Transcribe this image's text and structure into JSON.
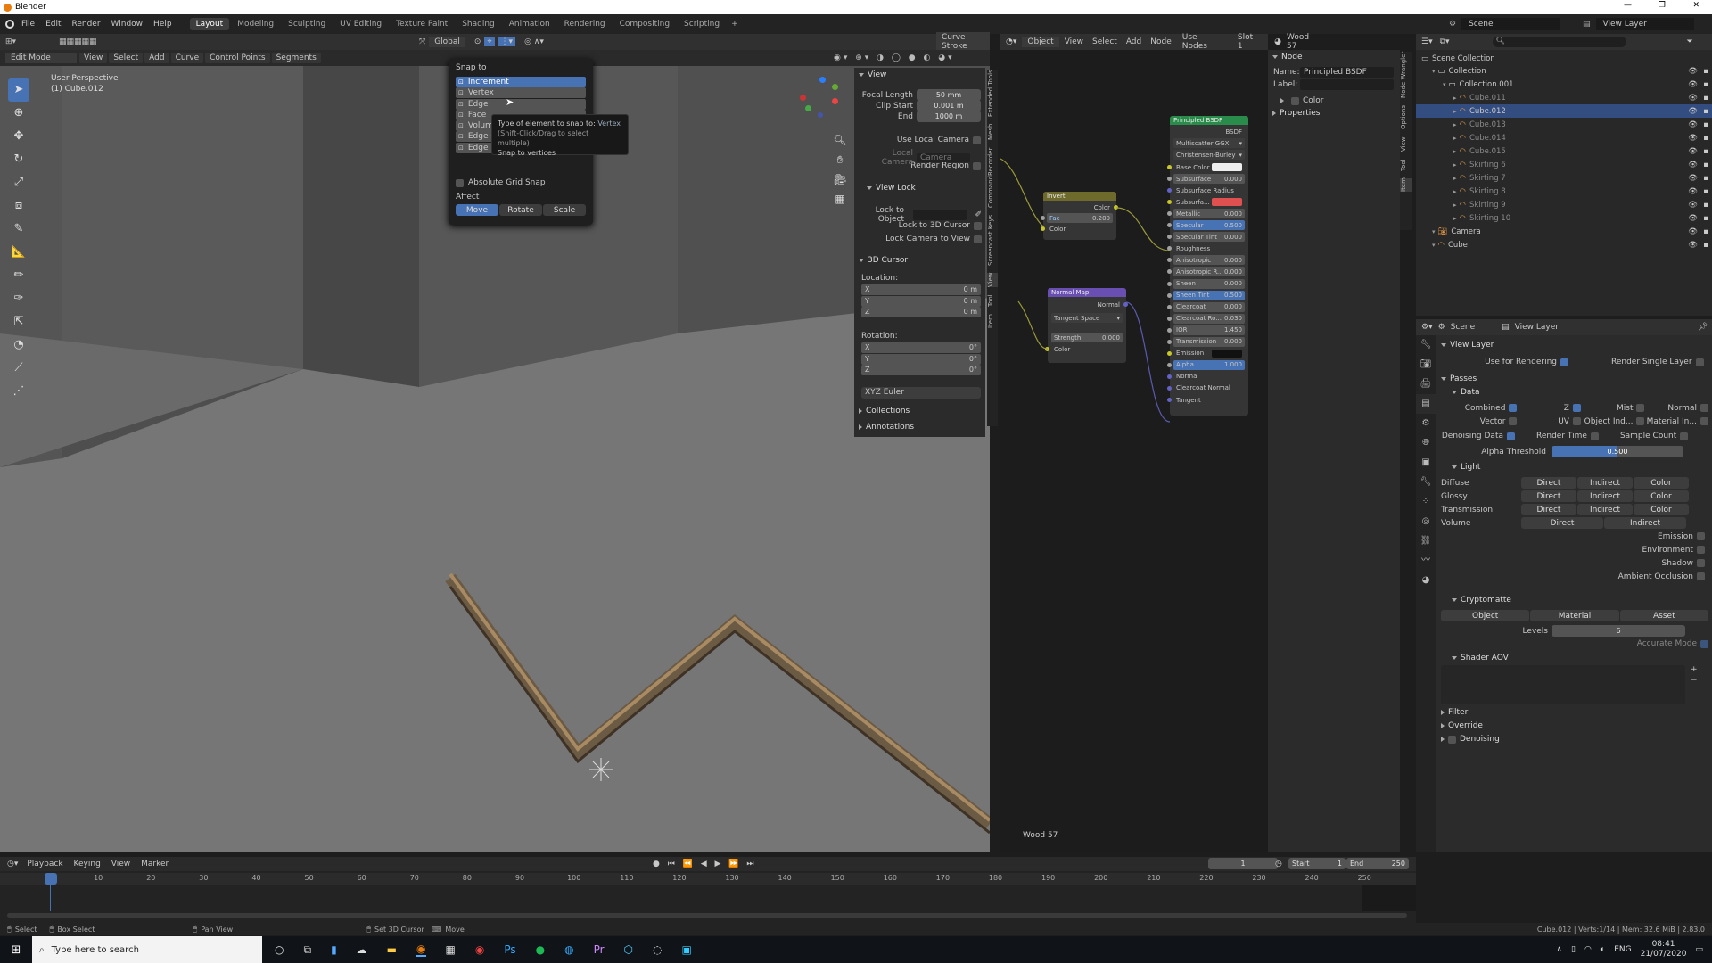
{
  "app_title": "Blender",
  "menu": [
    "File",
    "Edit",
    "Render",
    "Window",
    "Help"
  ],
  "workspaces": [
    "Layout",
    "Modeling",
    "Sculpting",
    "UV Editing",
    "Texture Paint",
    "Shading",
    "Animation",
    "Rendering",
    "Compositing",
    "Scripting"
  ],
  "scene": "Scene",
  "view_layer": "View Layer",
  "viewport": {
    "mode": "Edit Mode",
    "menus": [
      "View",
      "Select",
      "Add",
      "Curve",
      "Control Points",
      "Segments"
    ],
    "orientation": "Global",
    "curve_stroke": "Curve Stroke",
    "perspective": "User Perspective",
    "object_label": "(1) Cube.012"
  },
  "snap": {
    "title": "Snap to",
    "items": [
      "Increment",
      "Vertex",
      "Edge",
      "Face",
      "Volume",
      "Edge Center",
      "Edge Perpendicular"
    ],
    "absolute_grid": "Absolute Grid Snap",
    "affect": "Affect",
    "affect_buttons": [
      "Move",
      "Rotate",
      "Scale"
    ],
    "tooltip": {
      "line1_prefix": "Type of element to snap to:",
      "line1_value": "Vertex",
      "line2": "(Shift-Click/Drag to select multiple)",
      "line3": "Snap to vertices"
    }
  },
  "n_panel": {
    "view_header": "View",
    "focal_label": "Focal Length",
    "focal": "50 mm",
    "clip_start_label": "Clip Start",
    "clip_start": "0.001 m",
    "end_label": "End",
    "clip_end": "1000 m",
    "use_local_camera": "Use Local Camera",
    "local_camera": "Local Camera",
    "camera_placeholder": "Camera",
    "render_region": "Render Region",
    "view_lock": "View Lock",
    "lock_object": "Lock to Object",
    "lock_cursor": "Lock to 3D Cursor",
    "lock_camera": "Lock Camera to View",
    "cursor_header": "3D Cursor",
    "location": "Location:",
    "rotation": "Rotation:",
    "loc": [
      [
        "X",
        "0 m"
      ],
      [
        "Y",
        "0 m"
      ],
      [
        "Z",
        "0 m"
      ]
    ],
    "rot": [
      [
        "X",
        "0°"
      ],
      [
        "Y",
        "0°"
      ],
      [
        "Z",
        "0°"
      ]
    ],
    "euler": "XYZ Euler",
    "collections": "Collections",
    "annotations": "Annotations",
    "tabs": [
      "Item",
      "Tool",
      "View",
      "Screencast Keys",
      "CommandRecorder",
      "Mesh",
      "Extended Tools"
    ]
  },
  "node_editor": {
    "object": "Object",
    "menus": [
      "View",
      "Select",
      "Add",
      "Node"
    ],
    "use_nodes": "Use Nodes",
    "slot": "Slot 1",
    "material": "Wood 57",
    "footer_material": "Wood 57",
    "invert": {
      "title": "Invert",
      "out": "Color",
      "fac": "Fac",
      "fac_val": "0.200",
      "color": "Color"
    },
    "normal_map": {
      "title": "Normal Map",
      "out": "Normal",
      "space": "Tangent Space",
      "strength": "Strength",
      "strength_val": "0.000",
      "color": "Color"
    },
    "bsdf": {
      "title": "Principled BSDF",
      "out": "BSDF",
      "dist": "Multiscatter GGX",
      "sss": "Christensen-Burley",
      "rows": [
        [
          "Base Color",
          ""
        ],
        [
          "Subsurface",
          "0.000"
        ],
        [
          "Subsurface Radius",
          ""
        ],
        [
          "Subsurfa...",
          ""
        ],
        [
          "Metallic",
          "0.000"
        ],
        [
          "Specular",
          "0.500"
        ],
        [
          "Specular Tint",
          "0.000"
        ],
        [
          "Roughness",
          ""
        ],
        [
          "Anisotropic",
          "0.000"
        ],
        [
          "Anisotropic R...",
          "0.000"
        ],
        [
          "Sheen",
          "0.000"
        ],
        [
          "Sheen Tint",
          "0.500"
        ],
        [
          "Clearcoat",
          "0.000"
        ],
        [
          "Clearcoat Ro...",
          "0.030"
        ],
        [
          "IOR",
          "1.450"
        ],
        [
          "Transmission",
          "0.000"
        ],
        [
          "Emission",
          ""
        ],
        [
          "Alpha",
          "1.000"
        ],
        [
          "Normal",
          ""
        ],
        [
          "Clearcoat Normal",
          ""
        ],
        [
          "Tangent",
          ""
        ]
      ]
    }
  },
  "node_sidebar": {
    "header": "Node",
    "name_label": "Name:",
    "name": "Principled BSDF",
    "label_label": "Label:",
    "color": "Color",
    "properties": "Properties",
    "tabs": [
      "Item",
      "Tool",
      "View",
      "Options",
      "Node Wrangler"
    ]
  },
  "outliner": {
    "scene_collection": "Scene Collection",
    "items": [
      [
        "Collection",
        1
      ],
      [
        "Collection.001",
        2
      ],
      [
        "Cube.011",
        3
      ],
      [
        "Cube.012",
        3
      ],
      [
        "Cube.013",
        3
      ],
      [
        "Cube.014",
        3
      ],
      [
        "Cube.015",
        3
      ],
      [
        "Skirting 6",
        3
      ],
      [
        "Skirting 7",
        3
      ],
      [
        "Skirting 8",
        3
      ],
      [
        "Skirting 9",
        3
      ],
      [
        "Skirting 10",
        3
      ],
      [
        "Camera",
        1
      ],
      [
        "Cube",
        1
      ]
    ],
    "selected": "Cube.012"
  },
  "properties": {
    "scene": "Scene",
    "view_layer": "View Layer",
    "section": "View Layer",
    "use_for_rendering": "Use for Rendering",
    "render_single": "Render Single Layer",
    "passes": "Passes",
    "data": "Data",
    "data_rows": [
      [
        "Combined",
        "Z",
        "Mist",
        "Normal"
      ],
      [
        "Vector",
        "UV",
        "Object Ind...",
        "Material In..."
      ]
    ],
    "denoising_data": "Denoising Data",
    "render_time": "Render Time",
    "sample_count": "Sample Count",
    "alpha_threshold": "Alpha Threshold",
    "alpha_val": "0.500",
    "light": "Light",
    "light_rows": [
      "Diffuse",
      "Glossy",
      "Transmission"
    ],
    "direct": "Direct",
    "indirect": "Indirect",
    "color": "Color",
    "volume": "Volume",
    "emission": "Emission",
    "environment": "Environment",
    "shadow": "Shadow",
    "ao": "Ambient Occlusion",
    "cryptomatte": "Cryptomatte",
    "crypto_buttons": [
      "Object",
      "Material",
      "Asset"
    ],
    "levels": "Levels",
    "levels_val": "6",
    "accurate": "Accurate Mode",
    "shader_aov": "Shader AOV",
    "filter": "Filter",
    "override": "Override",
    "denoising": "Denoising"
  },
  "timeline": {
    "menus": [
      "Playback",
      "Keying",
      "View",
      "Marker"
    ],
    "frame": "1",
    "start_label": "Start",
    "start": "1",
    "end_label": "End",
    "end": "250",
    "ticks": [
      "1",
      "10",
      "20",
      "30",
      "40",
      "50",
      "60",
      "70",
      "80",
      "90",
      "100",
      "110",
      "120",
      "130",
      "140",
      "150",
      "160",
      "170",
      "180",
      "190",
      "200",
      "210",
      "220",
      "230",
      "240",
      "250"
    ]
  },
  "statusbar": {
    "select": "Select",
    "box_select": "Box Select",
    "pan": "Pan View",
    "set_cursor": "Set 3D Cursor",
    "move": "Move",
    "stats": "Cube.012 | Verts:1/14 | Mem: 32.6 MiB | 2.83.0"
  },
  "taskbar": {
    "search": "Type here to search",
    "lang": "ENG",
    "time": "08:41",
    "date": "21/07/2020"
  }
}
